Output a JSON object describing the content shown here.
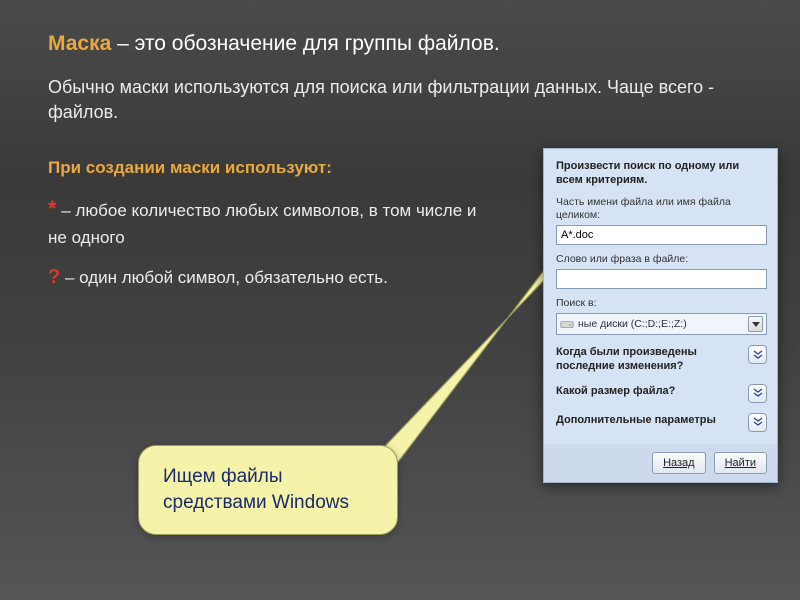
{
  "title": {
    "maska": "Маска",
    "rest": " – это обозначение для группы файлов."
  },
  "subtitle": "Обычно маски используются для поиска или фильтрации данных. Чаще всего - файлов.",
  "usage_head": "При создании маски используют:",
  "star": "*",
  "star_text": " – любое количество любых символов, в том числе и не одного",
  "qmark": "?",
  "qmark_text": " – один любой символ, обязательно есть.",
  "callout": "Ищем файлы средствами Windows",
  "panel": {
    "head": "Произвести поиск по одному или всем критериям.",
    "name_label": "Часть имени файла или имя файла целиком:",
    "name_value": "A*.doc",
    "phrase_label": "Слово или фраза в файле:",
    "phrase_value": "",
    "search_in_label": "Поиск в:",
    "search_in_value": "ные диски (C:;D:;E:;Z:)",
    "q_when": "Когда были произведены последние изменения?",
    "q_size": "Какой размер файла?",
    "q_extra": "Дополнительные параметры",
    "btn_back": "Назад",
    "btn_find": "Найти"
  }
}
